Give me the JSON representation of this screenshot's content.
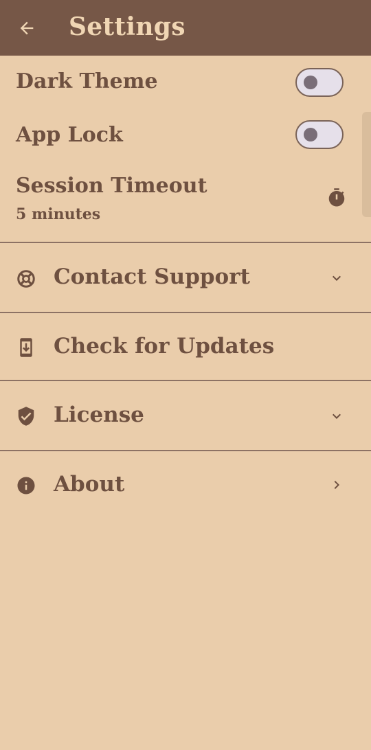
{
  "appbar": {
    "title": "Settings",
    "back_icon": "arrow-left-icon"
  },
  "settings": {
    "dark_theme": {
      "label": "Dark Theme",
      "enabled": false
    },
    "app_lock": {
      "label": "App Lock",
      "enabled": false
    },
    "session_timeout": {
      "label": "Session Timeout",
      "value": "5 minutes",
      "icon": "timer-icon"
    }
  },
  "nav_items": [
    {
      "label": "Contact Support",
      "icon": "lifebuoy-icon",
      "trailing": "chevron-down-icon"
    },
    {
      "label": "Check for Updates",
      "icon": "phone-download-icon",
      "trailing": ""
    },
    {
      "label": "License",
      "icon": "shield-check-icon",
      "trailing": "chevron-down-icon"
    },
    {
      "label": "About",
      "icon": "info-icon",
      "trailing": "chevron-right-icon"
    }
  ],
  "colors": {
    "background": "#eacdab",
    "appbar": "#765747",
    "appbar_text": "#f0d6b4",
    "text": "#6e5040",
    "toggle_track": "#e6e0ea",
    "divider": "#8d7264"
  }
}
